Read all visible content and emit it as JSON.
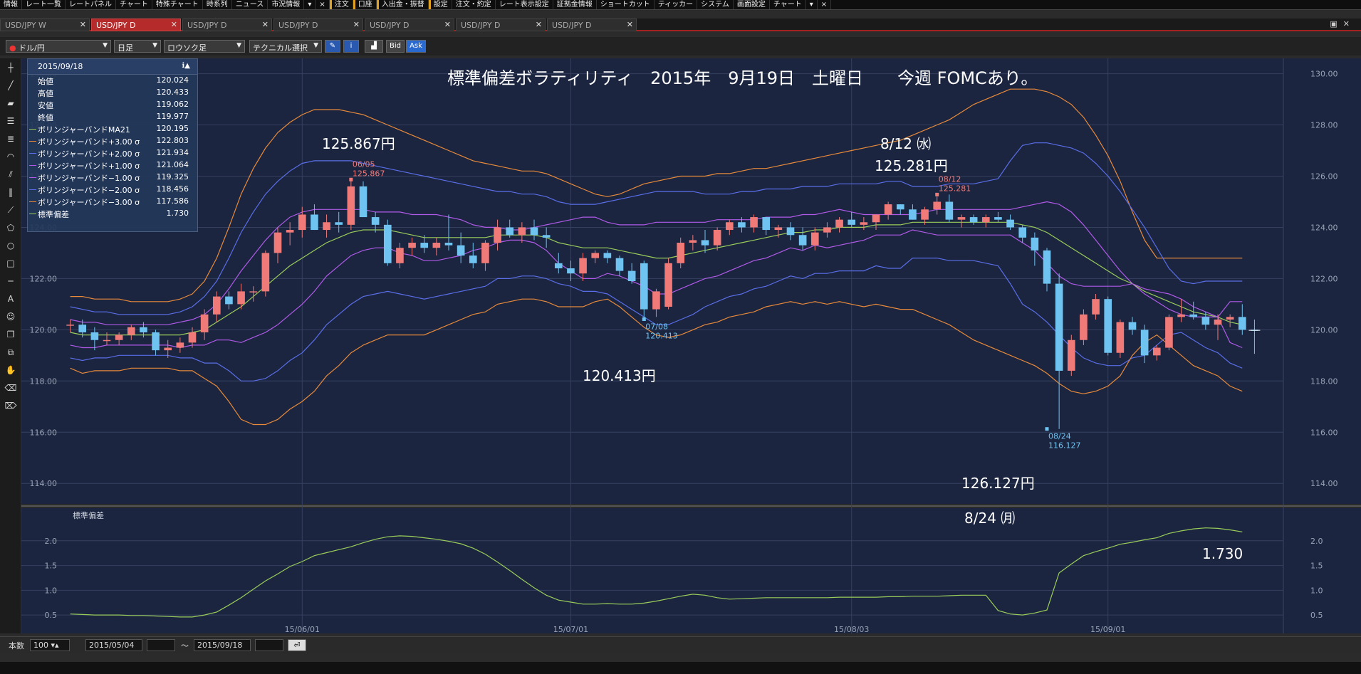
{
  "menu": [
    "情報",
    "レート一覧",
    "レートパネル",
    "チャート",
    "特殊チャート",
    "時系列",
    "ニュース",
    "市況情報",
    "▾",
    "×",
    "注文",
    "口座",
    "入出金・振替",
    "設定",
    "注文・約定",
    "レート表示設定",
    "証拠金情報",
    "ショートカット",
    "ティッカー",
    "システム",
    "画面設定",
    "チャート",
    "▾",
    "×"
  ],
  "tabs": [
    {
      "label": "USD/JPY W",
      "active": false
    },
    {
      "label": "USD/JPY D",
      "active": true
    },
    {
      "label": "USD/JPY D",
      "active": false
    },
    {
      "label": "USD/JPY D",
      "active": false
    },
    {
      "label": "USD/JPY D",
      "active": false
    },
    {
      "label": "USD/JPY D",
      "active": false
    },
    {
      "label": "USD/JPY D",
      "active": false
    }
  ],
  "toolbar": {
    "pair": "ドル/円",
    "timeframe": "日足",
    "chart_style": "ロウソク足",
    "technical": "テクニカル選択",
    "bid": "Bid",
    "ask": "Ask"
  },
  "info": {
    "date": "2015/09/18",
    "rows": [
      {
        "label": "始値",
        "value": "120.024",
        "color": ""
      },
      {
        "label": "高値",
        "value": "120.433",
        "color": ""
      },
      {
        "label": "安値",
        "value": "119.062",
        "color": ""
      },
      {
        "label": "終値",
        "value": "119.977",
        "color": ""
      },
      {
        "label": "ボリンジャーバンドMA21",
        "value": "120.195",
        "color": "#9acd5a"
      },
      {
        "label": "ボリンジャーバンド+3.00 σ",
        "value": "122.803",
        "color": "#e88a3a"
      },
      {
        "label": "ボリンジャーバンド+2.00 σ",
        "value": "121.934",
        "color": "#5a6ee8"
      },
      {
        "label": "ボリンジャーバンド+1.00 σ",
        "value": "121.064",
        "color": "#b05ae8"
      },
      {
        "label": "ボリンジャーバンド−1.00 σ",
        "value": "119.325",
        "color": "#b05ae8"
      },
      {
        "label": "ボリンジャーバンド−2.00 σ",
        "value": "118.456",
        "color": "#5a6ee8"
      },
      {
        "label": "ボリンジャーバンド−3.00 σ",
        "value": "117.586",
        "color": "#e88a3a"
      },
      {
        "label": "標準偏差",
        "value": "1.730",
        "color": "#9acd5a"
      }
    ]
  },
  "annotations": {
    "title": "標準偏差ボラティリティ　2015年　9月19日　土曜日　　今週 FOMCあり。",
    "a1": "125.867円",
    "a2": "8/12 ㈬",
    "a3": "125.281円",
    "a4": "120.413円",
    "a5": "126.127円",
    "a6": "8/24 ㈪",
    "a7": "1.730"
  },
  "chart_data": {
    "type": "candlestick",
    "series_name": "USD/JPY D",
    "price_ylim": [
      113.2,
      130.6
    ],
    "price_ticks": [
      "114.00",
      "116.00",
      "118.00",
      "120.00",
      "122.00",
      "124.00",
      "126.00",
      "128.00",
      "130.00"
    ],
    "sub_label": "標準偏差",
    "sub_ylim": [
      0.3,
      2.4
    ],
    "sub_ticks": [
      "0.5",
      "1.0",
      "1.5",
      "2.0"
    ],
    "x_labels": [
      {
        "i": 19,
        "label": "15/06/01"
      },
      {
        "i": 41,
        "label": "15/07/01"
      },
      {
        "i": 64,
        "label": "15/08/03"
      },
      {
        "i": 85,
        "label": "15/09/01"
      }
    ],
    "candles": [
      [
        120.2,
        120.4,
        119.9,
        120.2
      ],
      [
        120.2,
        120.4,
        119.7,
        119.9
      ],
      [
        119.9,
        120.1,
        119.2,
        119.6
      ],
      [
        119.6,
        119.9,
        119.4,
        119.6
      ],
      [
        119.6,
        119.9,
        119.4,
        119.8
      ],
      [
        119.8,
        120.2,
        119.6,
        120.1
      ],
      [
        120.1,
        120.3,
        119.7,
        119.9
      ],
      [
        119.9,
        120.0,
        119.0,
        119.2
      ],
      [
        119.2,
        119.6,
        118.9,
        119.3
      ],
      [
        119.3,
        119.7,
        119.1,
        119.5
      ],
      [
        119.5,
        120.1,
        119.3,
        119.9
      ],
      [
        119.9,
        120.8,
        119.6,
        120.6
      ],
      [
        120.6,
        121.5,
        120.3,
        121.3
      ],
      [
        121.3,
        121.5,
        120.8,
        121.0
      ],
      [
        121.0,
        121.8,
        120.8,
        121.5
      ],
      [
        121.5,
        121.7,
        121.1,
        121.5
      ],
      [
        121.5,
        123.1,
        121.3,
        123.0
      ],
      [
        123.0,
        124.0,
        122.6,
        123.8
      ],
      [
        123.8,
        124.2,
        123.3,
        123.9
      ],
      [
        123.9,
        124.8,
        123.6,
        124.5
      ],
      [
        124.5,
        124.9,
        123.9,
        123.9
      ],
      [
        123.9,
        124.5,
        123.6,
        124.2
      ],
      [
        124.2,
        124.6,
        123.8,
        124.1
      ],
      [
        124.1,
        125.867,
        123.9,
        125.6
      ],
      [
        125.6,
        125.8,
        124.4,
        124.4
      ],
      [
        124.4,
        124.6,
        123.8,
        124.1
      ],
      [
        124.1,
        124.3,
        122.5,
        122.6
      ],
      [
        122.6,
        123.4,
        122.4,
        123.2
      ],
      [
        123.2,
        123.6,
        122.9,
        123.4
      ],
      [
        123.4,
        123.7,
        123.0,
        123.2
      ],
      [
        123.2,
        123.6,
        122.9,
        123.4
      ],
      [
        123.4,
        124.5,
        123.1,
        123.3
      ],
      [
        123.3,
        123.8,
        122.6,
        122.9
      ],
      [
        122.9,
        123.4,
        122.4,
        122.6
      ],
      [
        122.6,
        123.5,
        122.3,
        123.4
      ],
      [
        123.4,
        124.3,
        123.1,
        124.0
      ],
      [
        124.0,
        124.3,
        123.6,
        123.7
      ],
      [
        123.7,
        124.2,
        123.4,
        124.0
      ],
      [
        124.0,
        124.3,
        123.5,
        123.7
      ],
      [
        123.7,
        124.0,
        123.2,
        123.6
      ],
      [
        122.6,
        123.0,
        122.2,
        122.4
      ],
      [
        122.4,
        122.7,
        121.9,
        122.2
      ],
      [
        122.2,
        123.0,
        121.9,
        122.8
      ],
      [
        122.8,
        123.1,
        122.6,
        123.0
      ],
      [
        123.0,
        123.1,
        122.6,
        122.8
      ],
      [
        122.8,
        122.9,
        122.1,
        122.3
      ],
      [
        122.3,
        122.6,
        121.8,
        121.9
      ],
      [
        122.6,
        122.7,
        120.413,
        120.8
      ],
      [
        120.8,
        121.6,
        120.5,
        121.5
      ],
      [
        120.9,
        122.8,
        120.8,
        122.6
      ],
      [
        122.6,
        123.6,
        122.4,
        123.4
      ],
      [
        123.4,
        123.7,
        123.1,
        123.5
      ],
      [
        123.5,
        123.9,
        123.0,
        123.3
      ],
      [
        123.3,
        124.0,
        123.1,
        123.9
      ],
      [
        123.9,
        124.3,
        123.7,
        124.2
      ],
      [
        124.2,
        124.4,
        123.8,
        124.0
      ],
      [
        124.0,
        124.5,
        123.8,
        124.4
      ],
      [
        124.4,
        124.4,
        123.7,
        123.9
      ],
      [
        123.9,
        124.1,
        123.6,
        124.0
      ],
      [
        124.0,
        124.2,
        123.5,
        123.7
      ],
      [
        123.7,
        124.0,
        123.1,
        123.3
      ],
      [
        123.3,
        124.0,
        123.1,
        123.8
      ],
      [
        123.8,
        124.2,
        123.6,
        124.0
      ],
      [
        124.0,
        124.4,
        123.8,
        124.3
      ],
      [
        124.3,
        124.6,
        124.0,
        124.1
      ],
      [
        124.1,
        124.4,
        123.9,
        124.2
      ],
      [
        124.2,
        124.5,
        123.9,
        124.5
      ],
      [
        124.5,
        125.0,
        124.3,
        124.9
      ],
      [
        124.9,
        124.9,
        124.5,
        124.7
      ],
      [
        124.7,
        124.9,
        124.3,
        124.3
      ],
      [
        124.3,
        124.8,
        124.1,
        124.7
      ],
      [
        124.7,
        125.2,
        124.5,
        125.0
      ],
      [
        125.0,
        125.281,
        124.2,
        124.3
      ],
      [
        124.3,
        124.5,
        124.0,
        124.4
      ],
      [
        124.4,
        124.5,
        124.1,
        124.2
      ],
      [
        124.2,
        124.5,
        124.0,
        124.4
      ],
      [
        124.4,
        124.6,
        124.2,
        124.3
      ],
      [
        124.3,
        124.5,
        123.9,
        124.0
      ],
      [
        124.0,
        124.1,
        123.4,
        123.6
      ],
      [
        123.6,
        123.8,
        122.5,
        123.1
      ],
      [
        123.1,
        123.2,
        121.5,
        121.8
      ],
      [
        121.8,
        122.2,
        116.127,
        118.4
      ],
      [
        118.4,
        119.8,
        118.2,
        119.6
      ],
      [
        119.6,
        120.8,
        119.4,
        120.6
      ],
      [
        120.6,
        121.4,
        120.4,
        121.2
      ],
      [
        121.2,
        121.3,
        119.0,
        119.1
      ],
      [
        119.1,
        120.4,
        118.9,
        120.3
      ],
      [
        120.3,
        120.5,
        119.8,
        120.0
      ],
      [
        120.0,
        120.2,
        118.7,
        119.0
      ],
      [
        119.0,
        119.4,
        118.8,
        119.3
      ],
      [
        119.3,
        120.6,
        119.2,
        120.5
      ],
      [
        120.5,
        121.2,
        120.3,
        120.6
      ],
      [
        120.6,
        121.1,
        120.4,
        120.5
      ],
      [
        120.5,
        120.7,
        120.0,
        120.2
      ],
      [
        120.2,
        120.6,
        119.6,
        120.4
      ],
      [
        120.4,
        120.6,
        120.1,
        120.5
      ],
      [
        120.5,
        121.0,
        119.8,
        120.0
      ],
      [
        120.0,
        120.4,
        119.06,
        119.98
      ]
    ],
    "bands": {
      "ma21": [
        119.9,
        119.8,
        119.8,
        119.8,
        119.8,
        119.8,
        119.8,
        119.8,
        119.8,
        119.8,
        119.9,
        120.0,
        120.3,
        120.6,
        120.9,
        121.3,
        121.7,
        122.1,
        122.5,
        122.8,
        123.1,
        123.4,
        123.6,
        123.8,
        123.9,
        123.9,
        123.9,
        123.8,
        123.7,
        123.6,
        123.6,
        123.6,
        123.6,
        123.6,
        123.6,
        123.7,
        123.7,
        123.7,
        123.7,
        123.6,
        123.4,
        123.3,
        123.2,
        123.2,
        123.2,
        123.1,
        123.0,
        122.9,
        122.8,
        122.8,
        122.9,
        123.0,
        123.1,
        123.2,
        123.3,
        123.4,
        123.5,
        123.6,
        123.7,
        123.8,
        123.8,
        123.9,
        123.9,
        124.0,
        124.0,
        124.0,
        124.1,
        124.1,
        124.1,
        124.2,
        124.2,
        124.2,
        124.2,
        124.2,
        124.2,
        124.2,
        124.2,
        124.2,
        124.1,
        124.0,
        123.8,
        123.5,
        123.2,
        122.9,
        122.6,
        122.3,
        122.0,
        121.8,
        121.5,
        121.3,
        121.1,
        120.9,
        120.7,
        120.6,
        120.5,
        120.3,
        120.2
      ],
      "p1": [
        120.4,
        120.3,
        120.3,
        120.2,
        120.2,
        120.2,
        120.2,
        120.2,
        120.2,
        120.3,
        120.4,
        120.6,
        121.0,
        121.6,
        122.3,
        122.9,
        123.5,
        124.0,
        124.4,
        124.6,
        124.7,
        124.7,
        124.7,
        124.7,
        124.7,
        124.6,
        124.6,
        124.6,
        124.5,
        124.5,
        124.5,
        124.4,
        124.3,
        124.1,
        124.0,
        124.0,
        123.9,
        123.9,
        124.0,
        124.1,
        124.2,
        124.3,
        124.4,
        124.4,
        124.2,
        124.1,
        124.1,
        124.1,
        124.2,
        124.2,
        124.2,
        124.2,
        124.2,
        124.3,
        124.3,
        124.3,
        124.3,
        124.4,
        124.4,
        124.4,
        124.5,
        124.5,
        124.6,
        124.7,
        124.6,
        124.5,
        124.5,
        124.5,
        124.5,
        124.5,
        124.6,
        124.7,
        124.7,
        124.7,
        124.7,
        124.7,
        124.7,
        124.7,
        124.8,
        124.9,
        125.0,
        124.9,
        124.6,
        124.1,
        123.5,
        122.9,
        122.3,
        121.8,
        121.4,
        121.1,
        120.8,
        120.6,
        120.5,
        120.5,
        120.5,
        121.1,
        121.1
      ],
      "p2": [
        120.9,
        120.8,
        120.7,
        120.7,
        120.6,
        120.6,
        120.6,
        120.6,
        120.6,
        120.7,
        120.9,
        121.3,
        121.9,
        122.8,
        123.8,
        124.6,
        125.3,
        125.8,
        126.2,
        126.5,
        126.6,
        126.6,
        126.6,
        126.6,
        126.5,
        126.4,
        126.3,
        126.2,
        126.1,
        126.0,
        125.9,
        125.8,
        125.7,
        125.6,
        125.5,
        125.4,
        125.4,
        125.3,
        125.3,
        125.2,
        125.0,
        124.9,
        124.9,
        124.9,
        125.0,
        125.1,
        125.2,
        125.3,
        125.4,
        125.4,
        125.4,
        125.4,
        125.3,
        125.3,
        125.3,
        125.4,
        125.4,
        125.5,
        125.5,
        125.5,
        125.6,
        125.6,
        125.6,
        125.7,
        125.7,
        125.7,
        125.7,
        125.8,
        125.8,
        125.6,
        125.6,
        125.6,
        125.7,
        125.7,
        125.7,
        125.8,
        125.9,
        126.6,
        127.2,
        127.3,
        127.3,
        127.2,
        127.1,
        126.9,
        126.5,
        126.0,
        125.4,
        124.7,
        124.0,
        123.2,
        122.4,
        121.9,
        121.8,
        121.9,
        121.9,
        121.9,
        121.9
      ],
      "p3": [
        121.3,
        121.3,
        121.2,
        121.2,
        121.2,
        121.1,
        121.1,
        121.1,
        121.1,
        121.2,
        121.4,
        121.9,
        122.8,
        124.0,
        125.3,
        126.3,
        127.1,
        127.7,
        128.1,
        128.4,
        128.6,
        128.6,
        128.6,
        128.5,
        128.4,
        128.2,
        128.0,
        127.8,
        127.6,
        127.4,
        127.2,
        127.0,
        126.8,
        126.6,
        126.5,
        126.4,
        126.3,
        126.2,
        126.2,
        126.1,
        125.9,
        125.7,
        125.5,
        125.3,
        125.2,
        125.3,
        125.5,
        125.7,
        125.8,
        125.9,
        126.0,
        126.0,
        126.0,
        126.1,
        126.1,
        126.2,
        126.3,
        126.3,
        126.4,
        126.5,
        126.6,
        126.7,
        126.8,
        126.9,
        127.0,
        127.1,
        127.2,
        127.3,
        127.4,
        127.6,
        127.8,
        128.0,
        128.2,
        128.5,
        128.8,
        129.0,
        129.2,
        129.4,
        129.4,
        129.4,
        129.3,
        129.1,
        128.8,
        128.3,
        127.6,
        126.8,
        125.8,
        124.6,
        123.5,
        122.8,
        122.8,
        122.8,
        122.8,
        122.8,
        122.8,
        122.8,
        122.8
      ]
    },
    "stdev": [
      0.52,
      0.51,
      0.5,
      0.5,
      0.5,
      0.49,
      0.49,
      0.48,
      0.47,
      0.46,
      0.46,
      0.5,
      0.56,
      0.7,
      0.85,
      1.02,
      1.19,
      1.33,
      1.48,
      1.58,
      1.7,
      1.76,
      1.82,
      1.88,
      1.96,
      2.03,
      2.08,
      2.1,
      2.09,
      2.06,
      2.03,
      1.99,
      1.94,
      1.85,
      1.73,
      1.57,
      1.4,
      1.22,
      1.05,
      0.9,
      0.8,
      0.76,
      0.72,
      0.72,
      0.73,
      0.72,
      0.72,
      0.74,
      0.78,
      0.83,
      0.88,
      0.92,
      0.9,
      0.85,
      0.82,
      0.83,
      0.84,
      0.85,
      0.85,
      0.85,
      0.85,
      0.85,
      0.85,
      0.86,
      0.86,
      0.86,
      0.86,
      0.87,
      0.87,
      0.88,
      0.88,
      0.88,
      0.89,
      0.9,
      0.9,
      0.9,
      0.59,
      0.52,
      0.5,
      0.54,
      0.6,
      1.35,
      1.53,
      1.7,
      1.78,
      1.85,
      1.93,
      1.97,
      2.02,
      2.06,
      2.15,
      2.2,
      2.24,
      2.26,
      2.25,
      2.22,
      2.18
    ]
  }
}
